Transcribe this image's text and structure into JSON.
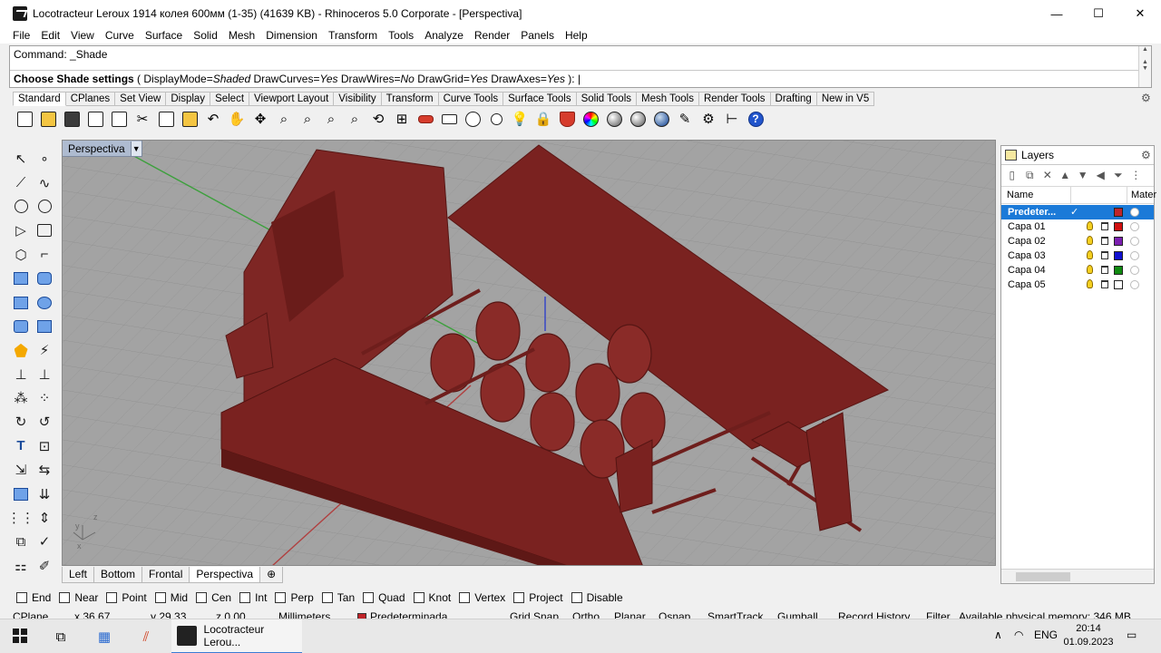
{
  "window": {
    "title": "Locotracteur Leroux 1914 колея 600мм (1-35) (41639 KB) - Rhinoceros  5.0 Corporate - [Perspectiva]",
    "min": "—",
    "max": "☐",
    "close": "✕"
  },
  "menu": [
    "File",
    "Edit",
    "View",
    "Curve",
    "Surface",
    "Solid",
    "Mesh",
    "Dimension",
    "Transform",
    "Tools",
    "Analyze",
    "Render",
    "Panels",
    "Help"
  ],
  "command": {
    "history": "Command: _Shade",
    "prompt_bold": "Choose Shade settings",
    "prompt_rest_1": " ( DisplayMode=",
    "displaymode": "Shaded",
    "prompt_rest_2": "  DrawCurves=",
    "drawcurves": "Yes",
    "prompt_rest_3": "  DrawWires=",
    "drawwires": "No",
    "prompt_rest_4": "  DrawGrid=",
    "drawgrid": "Yes",
    "prompt_rest_5": "  DrawAxes=",
    "drawaxes": "Yes",
    "prompt_end": " ): "
  },
  "toolbar_tabs": [
    "Standard",
    "CPlanes",
    "Set View",
    "Display",
    "Select",
    "Viewport Layout",
    "Visibility",
    "Transform",
    "Curve Tools",
    "Surface Tools",
    "Solid Tools",
    "Mesh Tools",
    "Render Tools",
    "Drafting",
    "New in V5"
  ],
  "toolbar_icons": [
    "new-icon",
    "open-icon",
    "save-icon",
    "print-icon",
    "import-icon",
    "cut-icon",
    "copy-icon",
    "paste-icon",
    "undo-icon",
    "pan-icon",
    "move-icon",
    "zoom-icon",
    "zoom-window-icon",
    "zoom-extents-icon",
    "zoom-selected-icon",
    "rotate-view-icon",
    "four-viewports-icon",
    "car-icon",
    "rectangle-icon",
    "circle-icon",
    "camera-icon",
    "light-icon",
    "lock-icon",
    "render-shield-icon",
    "color-wheel-icon",
    "shade-ball-icon",
    "render-ball-icon",
    "blue-ball-icon",
    "pencil-icon",
    "gear-icon",
    "dimension-icon",
    "help-icon"
  ],
  "viewport": {
    "label": "Perspectiva",
    "arrow": "▼"
  },
  "viewport_tabs": [
    "Left",
    "Bottom",
    "Frontal",
    "Perspectiva",
    "⊕"
  ],
  "layers": {
    "tab": "Layers",
    "col_name": "Name",
    "col_material": "Mater",
    "rows": [
      {
        "name": "Predeter...",
        "check": "✓",
        "color": "#c0252a",
        "selected": true
      },
      {
        "name": "Capa 01",
        "check": "",
        "color": "#d01010",
        "selected": false
      },
      {
        "name": "Capa 02",
        "check": "",
        "color": "#7b1fb0",
        "selected": false
      },
      {
        "name": "Capa 03",
        "check": "",
        "color": "#1010d0",
        "selected": false
      },
      {
        "name": "Capa 04",
        "check": "",
        "color": "#108a10",
        "selected": false
      },
      {
        "name": "Capa 05",
        "check": "",
        "color": "#ffffff",
        "selected": false
      }
    ]
  },
  "osnap": [
    "End",
    "Near",
    "Point",
    "Mid",
    "Cen",
    "Int",
    "Perp",
    "Tan",
    "Quad",
    "Knot",
    "Vertex",
    "Project",
    "Disable"
  ],
  "status": {
    "cplane": "CPlane",
    "x": "x 36.67",
    "y": "y 29.33",
    "z": "z 0.00",
    "units": "Millimeters",
    "layer": "Predeterminada",
    "gridsnap": "Grid Snap",
    "ortho": "Ortho",
    "planar": "Planar",
    "osnap": "Osnap",
    "smarttrack": "SmartTrack",
    "gumball": "Gumball",
    "record": "Record History",
    "filter": "Filter",
    "memory": "Available physical memory: 346 MB"
  },
  "taskbar": {
    "task_label": "Locotracteur Lerou...",
    "lang": "ENG",
    "time": "20:14",
    "date": "01.09.2023"
  },
  "colors": {
    "model": "#7a2220",
    "viewport_bg": "#a3a3a3",
    "accent": "#1b7ad8"
  }
}
